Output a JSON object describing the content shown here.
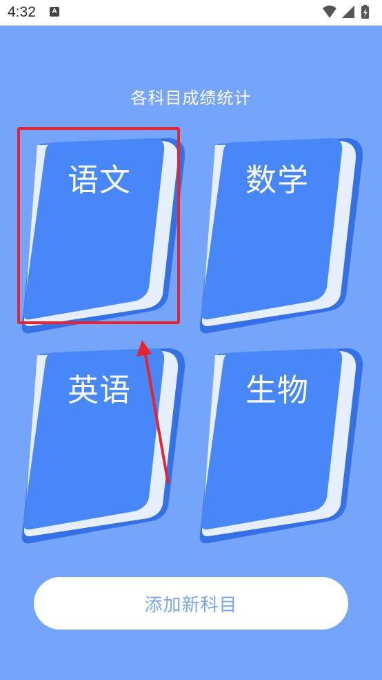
{
  "status_bar": {
    "time": "4:32",
    "notification_icon_glyph": "A"
  },
  "page": {
    "title": "各科目成绩统计"
  },
  "subjects": [
    {
      "label": "语文",
      "selected": true
    },
    {
      "label": "数学",
      "selected": false
    },
    {
      "label": "英语",
      "selected": false
    },
    {
      "label": "生物",
      "selected": false
    }
  ],
  "add_button": {
    "label": "添加新科目"
  },
  "colors": {
    "background": "#75a5fb",
    "book_cover": "#4787f8",
    "book_pages": "#e6efff",
    "book_edge": "#3470e6",
    "highlight": "#e8232b",
    "button_text": "#7aa4ee"
  }
}
